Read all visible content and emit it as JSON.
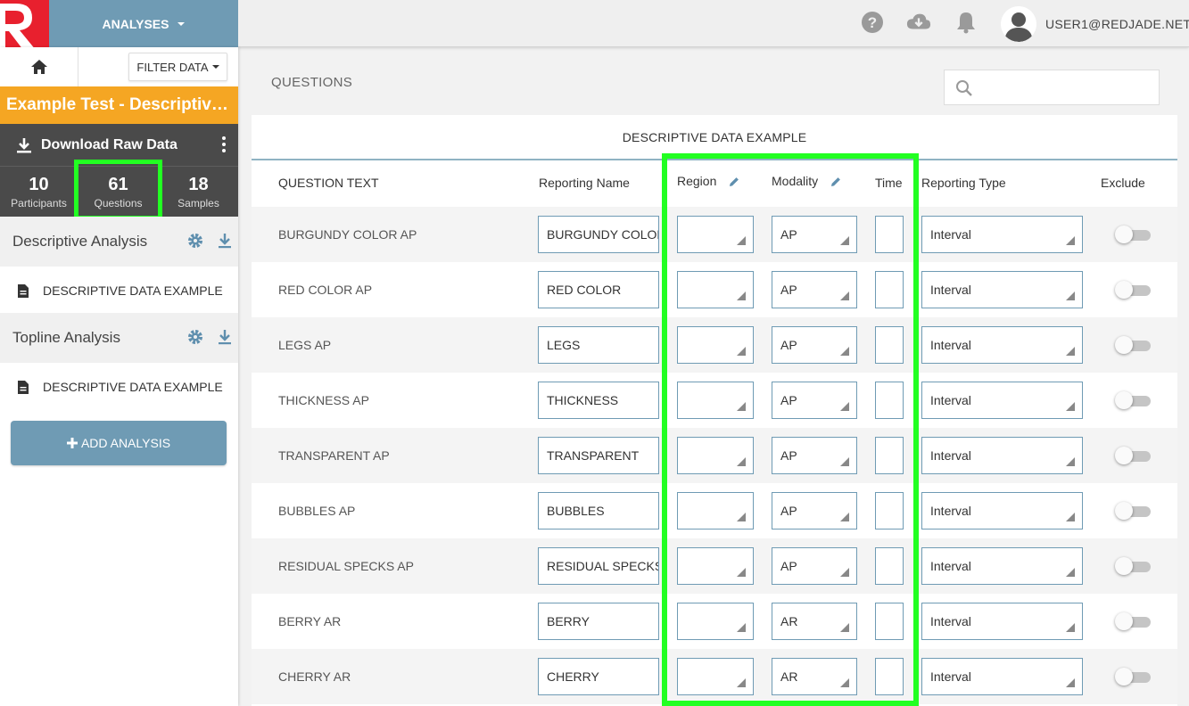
{
  "header": {
    "analyses_label": "ANALYSES",
    "user_name": "USER1@REDJADE.NET"
  },
  "sidebar": {
    "filter_label": "FILTER DATA",
    "test_title": "Example Test - Descriptive Data",
    "download_raw_label": "Download Raw Data",
    "stats": [
      {
        "num": "10",
        "label": "Participants"
      },
      {
        "num": "61",
        "label": "Questions"
      },
      {
        "num": "18",
        "label": "Samples"
      }
    ],
    "analyses": [
      {
        "title": "Descriptive Analysis",
        "item": "DESCRIPTIVE DATA EXAMPLE"
      },
      {
        "title": "Topline Analysis",
        "item": "DESCRIPTIVE DATA EXAMPLE"
      }
    ],
    "add_analysis_label": "ADD ANALYSIS"
  },
  "main": {
    "title": "QUESTIONS",
    "search_value": "",
    "card_title": "DESCRIPTIVE DATA EXAMPLE",
    "columns": {
      "question_text": "QUESTION TEXT",
      "reporting_name": "Reporting Name",
      "region": "Region",
      "modality": "Modality",
      "time": "Time",
      "reporting_type": "Reporting Type",
      "exclude": "Exclude"
    },
    "rows": [
      {
        "question": "BURGUNDY COLOR AP",
        "reporting_name": "BURGUNDY COLOR",
        "region": "",
        "modality": "AP",
        "time": "",
        "reporting_type": "Interval",
        "exclude": false
      },
      {
        "question": "RED COLOR AP",
        "reporting_name": "RED COLOR",
        "region": "",
        "modality": "AP",
        "time": "",
        "reporting_type": "Interval",
        "exclude": false
      },
      {
        "question": "LEGS AP",
        "reporting_name": "LEGS",
        "region": "",
        "modality": "AP",
        "time": "",
        "reporting_type": "Interval",
        "exclude": false
      },
      {
        "question": "THICKNESS AP",
        "reporting_name": "THICKNESS",
        "region": "",
        "modality": "AP",
        "time": "",
        "reporting_type": "Interval",
        "exclude": false
      },
      {
        "question": "TRANSPARENT AP",
        "reporting_name": "TRANSPARENT",
        "region": "",
        "modality": "AP",
        "time": "",
        "reporting_type": "Interval",
        "exclude": false
      },
      {
        "question": "BUBBLES AP",
        "reporting_name": "BUBBLES",
        "region": "",
        "modality": "AP",
        "time": "",
        "reporting_type": "Interval",
        "exclude": false
      },
      {
        "question": "RESIDUAL SPECKS AP",
        "reporting_name": "RESIDUAL SPECKS",
        "region": "",
        "modality": "AP",
        "time": "",
        "reporting_type": "Interval",
        "exclude": false
      },
      {
        "question": "BERRY AR",
        "reporting_name": "BERRY",
        "region": "",
        "modality": "AR",
        "time": "",
        "reporting_type": "Interval",
        "exclude": false
      },
      {
        "question": "CHERRY AR",
        "reporting_name": "CHERRY",
        "region": "",
        "modality": "AR",
        "time": "",
        "reporting_type": "Interval",
        "exclude": false
      }
    ]
  },
  "colors": {
    "brand_red": "#e8202e",
    "steel_blue": "#6f9bb4",
    "orange": "#f5a623",
    "dark_gray": "#4a4a4a",
    "highlight_green": "#22ff22"
  },
  "icons": [
    "logo-r-icon",
    "help-icon",
    "cloud-download-icon",
    "bell-icon",
    "avatar-icon",
    "home-icon",
    "download-icon",
    "kebab-icon",
    "gear-icon",
    "file-icon",
    "plus-icon",
    "search-icon",
    "pencil-icon"
  ]
}
